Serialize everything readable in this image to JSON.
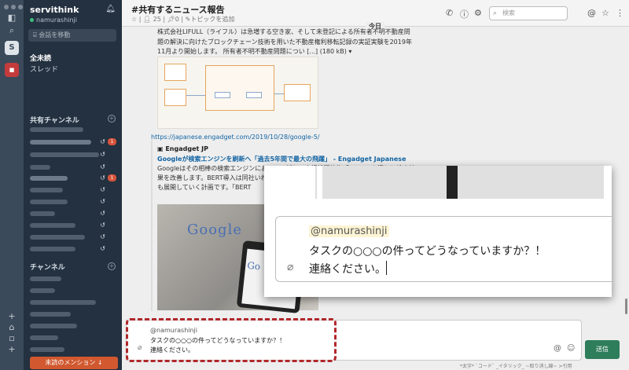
{
  "workspace": {
    "name": "servithink",
    "user": "namurashinji"
  },
  "sidebar": {
    "jump_label": "会話を移動",
    "all_unread": "全未読",
    "threads": "スレッド",
    "shared_channels_heading": "共有チャンネル",
    "channels_heading": "チャンネル",
    "shared_channel_badges": [
      "1",
      "1"
    ],
    "mentions_button": "未読のメンション ↓"
  },
  "header": {
    "channel_title": "#共有するニュース報告",
    "members": "25",
    "pins": "0",
    "add_topic": "トピックを追加",
    "search_placeholder": "検索"
  },
  "feed": {
    "today_label": "今日",
    "message_text": "株式会社LIFULL（ライフル）は急増する空き家、そして未登記による所有者不明不動産問題の解決に向けたブロックチェーン技術を用いた不動産権利移転記録の実証実験を2019年11月より開始します。 所有者不明不動産問題につい [...] (180 kB) ▾",
    "link_url": "https://japanese.engadget.com/2019/10/28/google-5/",
    "source_name": "Engadget JP",
    "article_title": "Googleが検索エンジンを刷新へ「過去5年間で最大の飛躍」 - Engadget Japanese",
    "article_desc": "Googleはその相棒の検索エンジンにおいて、新しい言語処理技術「BERT」を導入し検索結果を改善します。BERT導入は同社いわく、で最大の飛躍を遂げる」改良となるもの、語へも展開していく計画です。「BERT"
  },
  "composer": {
    "mention": "@namurashinji",
    "line1": "タスクの○○○の件ってどうなっていますか？！",
    "line2": "連絡ください。",
    "send_label": "送信",
    "format_hint": "*太字* `コード` _イタリック_ ~取り消し線~ >引用"
  },
  "icons": {
    "header": [
      "phone-icon",
      "info-icon",
      "settings-icon",
      "at-icon",
      "star-icon",
      "more-icon"
    ],
    "rail": [
      "search-icon",
      "add-icon",
      "bell-icon",
      "doc-icon",
      "plus-icon"
    ]
  },
  "colors": {
    "sidebar": "#233140",
    "accent": "#2e7d5b",
    "mention_button": "#d1582f",
    "highlight_border": "#b0282c"
  }
}
